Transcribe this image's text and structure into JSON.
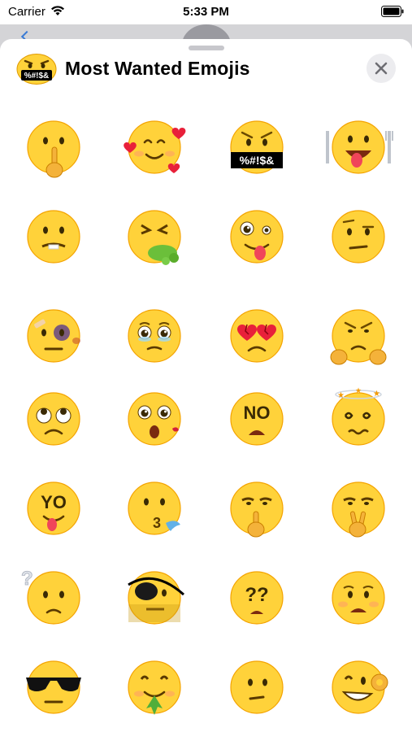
{
  "status_bar": {
    "carrier": "Carrier",
    "time": "5:33 PM"
  },
  "sheet": {
    "title": "Most Wanted Emojis",
    "header_icon_text": "%#!$&",
    "close_icon": "close-icon"
  },
  "emojis": [
    {
      "name": "shushing-face",
      "text": ""
    },
    {
      "name": "smiling-face-with-hearts",
      "text": ""
    },
    {
      "name": "face-with-symbols-on-mouth",
      "text": "%#!$&"
    },
    {
      "name": "hungry-face-with-fork-and-knife",
      "text": ""
    },
    {
      "name": "face-biting-lip",
      "text": ""
    },
    {
      "name": "face-vomiting",
      "text": ""
    },
    {
      "name": "zany-face",
      "text": ""
    },
    {
      "name": "face-with-raised-eyebrow",
      "text": ""
    },
    {
      "name": "bruised-face",
      "text": ""
    },
    {
      "name": "pleading-face",
      "text": ""
    },
    {
      "name": "broken-heart-eyes-face",
      "text": ""
    },
    {
      "name": "grumpy-face-with-fists",
      "text": ""
    },
    {
      "name": "face-rolling-eyes",
      "text": ""
    },
    {
      "name": "shocked-face-with-kiss",
      "text": ""
    },
    {
      "name": "no-face",
      "text": "NO"
    },
    {
      "name": "dizzy-face",
      "text": ""
    },
    {
      "name": "yo-face",
      "text": "YO"
    },
    {
      "name": "face-blowing-kiss-wind",
      "text": ""
    },
    {
      "name": "face-pointing-finger",
      "text": ""
    },
    {
      "name": "face-peace-sign",
      "text": ""
    },
    {
      "name": "confused-face-question",
      "text": ""
    },
    {
      "name": "pirate-face-eyepatch",
      "text": ""
    },
    {
      "name": "question-eyes-face",
      "text": "??"
    },
    {
      "name": "anxious-face",
      "text": ""
    },
    {
      "name": "face-with-sunglasses",
      "text": ""
    },
    {
      "name": "face-with-leaf",
      "text": ""
    },
    {
      "name": "neutral-face",
      "text": ""
    },
    {
      "name": "face-ok-hand",
      "text": ""
    }
  ],
  "colors": {
    "emoji_yellow": "#ffd23a",
    "emoji_orange": "#f4a300",
    "sheet_bg": "#ffffff",
    "close_button_bg": "#ececef"
  }
}
